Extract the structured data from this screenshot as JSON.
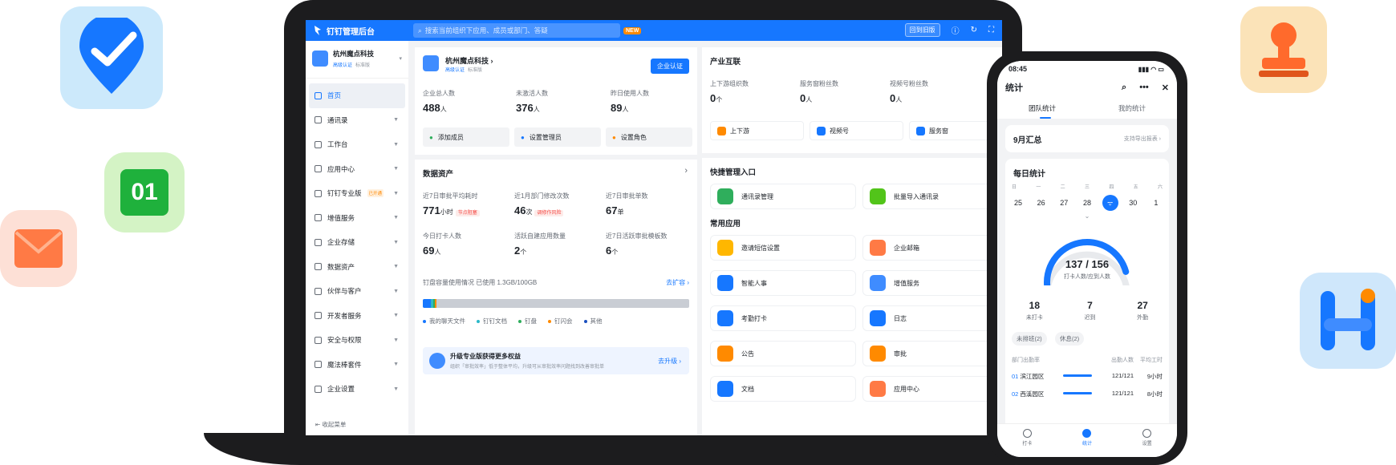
{
  "window": {
    "title": "钉钉管理后台"
  },
  "topbar": {
    "search_placeholder": "搜索当前组织下应用、成员或部门、答疑",
    "new_badge": "NEW",
    "back_old_label": "回到旧版"
  },
  "sidebar": {
    "org_name": "杭州魔点科技",
    "org_tag1": "高级认证",
    "org_tag2": "标准版",
    "items": [
      {
        "label": "首页"
      },
      {
        "label": "通讯录"
      },
      {
        "label": "工作台"
      },
      {
        "label": "应用中心"
      },
      {
        "label": "钉钉专业版",
        "badge": "已开通"
      },
      {
        "label": "增值服务"
      },
      {
        "label": "企业存储"
      },
      {
        "label": "数据资产"
      },
      {
        "label": "伙伴与客户"
      },
      {
        "label": "开发者服务"
      },
      {
        "label": "安全与权限"
      },
      {
        "label": "魔法棒套件"
      },
      {
        "label": "企业设置"
      }
    ],
    "collapse_label": "收起菜单"
  },
  "org_card": {
    "name": "杭州魔点科技",
    "tag1": "高级认证",
    "tag2": "标准版",
    "certify_button": "企业认证",
    "stats": [
      {
        "label": "企业总人数",
        "value": "488",
        "unit": "人"
      },
      {
        "label": "未激活人数",
        "value": "376",
        "unit": "人"
      },
      {
        "label": "昨日使用人数",
        "value": "89",
        "unit": "人"
      }
    ],
    "actions": [
      "添加成员",
      "设置管理员",
      "设置角色"
    ]
  },
  "data_assets": {
    "title": "数据资产",
    "stats": [
      {
        "label": "近7日审批平均耗时",
        "value": "771",
        "unit": "小时",
        "pill": "节点阻塞"
      },
      {
        "label": "近1月部门修改次数",
        "value": "46",
        "unit": "次",
        "pill": "调修作风险"
      },
      {
        "label": "近7日审批单数",
        "value": "67",
        "unit": "单"
      },
      {
        "label": "今日打卡人数",
        "value": "69",
        "unit": "人"
      },
      {
        "label": "活跃自建应用数量",
        "value": "2",
        "unit": "个"
      },
      {
        "label": "近7日活跃审批模板数",
        "value": "6",
        "unit": "个"
      }
    ],
    "storage_text": "钉盘容量使用情况 已使用 1.3GB/100GB",
    "expand_link": "去扩容",
    "legend": [
      {
        "label": "我的聊天文件",
        "color": "#1677ff"
      },
      {
        "label": "钉钉文档",
        "color": "#2bb8c9"
      },
      {
        "label": "钉盘",
        "color": "#2fae5c"
      },
      {
        "label": "钉闪会",
        "color": "#ff8a00"
      },
      {
        "label": "其他",
        "color": "#1a4fbf"
      }
    ],
    "upgrade_title": "升级专业版获得更多权益",
    "upgrade_desc": "组织「审批效率」低于整体平均，升级可从审批效率问题找到改善审批单",
    "upgrade_link": "去升级"
  },
  "industry": {
    "title": "产业互联",
    "stats": [
      {
        "label": "上下游组织数",
        "value": "0",
        "unit": "个"
      },
      {
        "label": "服务窗粉丝数",
        "value": "0",
        "unit": "人"
      },
      {
        "label": "视频号粉丝数",
        "value": "0",
        "unit": "人"
      }
    ],
    "chips": [
      {
        "label": "上下游",
        "color": "#ff8a00"
      },
      {
        "label": "视频号",
        "color": "#1677ff"
      },
      {
        "label": "服务窗",
        "color": "#1677ff"
      }
    ]
  },
  "quick": {
    "title": "快捷管理入口",
    "items": [
      {
        "label": "通讯录管理",
        "color": "#2fae5c"
      },
      {
        "label": "批量导入通讯录",
        "color": "#52c41a"
      }
    ]
  },
  "common_apps": {
    "title": "常用应用",
    "items": [
      {
        "label": "邀请短信设置",
        "color": "#ffb700"
      },
      {
        "label": "企业邮箱",
        "color": "#ff7a45"
      },
      {
        "label": "智能人事",
        "color": "#1677ff"
      },
      {
        "label": "增值服务",
        "color": "#3f8cff"
      },
      {
        "label": "考勤打卡",
        "color": "#1677ff"
      },
      {
        "label": "日志",
        "color": "#1677ff"
      },
      {
        "label": "公告",
        "color": "#ff8a00"
      },
      {
        "label": "审批",
        "color": "#ff8a00"
      },
      {
        "label": "文档",
        "color": "#1677ff"
      },
      {
        "label": "应用中心",
        "color": "#ff7a45"
      }
    ]
  },
  "phone": {
    "time": "08:45",
    "title": "统计",
    "tabs": [
      "团队统计",
      "我的统计"
    ],
    "month_title": "9月汇总",
    "export_link": "支持导出报表",
    "daily_title": "每日统计",
    "weekdays": [
      "日",
      "一",
      "二",
      "三",
      "四",
      "五",
      "六"
    ],
    "dates": [
      "25",
      "26",
      "27",
      "28",
      "29",
      "30",
      "1"
    ],
    "gauge_value": "137 / 156",
    "gauge_label": "打卡人数/应到人数",
    "gauge_fraction": 0.878,
    "summary": [
      {
        "value": "18",
        "label": "未打卡"
      },
      {
        "value": "7",
        "label": "迟到"
      },
      {
        "value": "27",
        "label": "外勤"
      }
    ],
    "tags": [
      "未排班(2)",
      "休息(2)"
    ],
    "dept_header": {
      "col1": "部门出勤率",
      "col2": "出勤人数",
      "col3": "平均工时"
    },
    "depts": [
      {
        "idx": "01",
        "name": "滨江园区",
        "count": "121/121",
        "hours": "9小时"
      },
      {
        "idx": "02",
        "name": "西溪园区",
        "count": "121/121",
        "hours": "8小时"
      }
    ],
    "nav": [
      "打卡",
      "统计",
      "设置"
    ]
  },
  "floating_icons": {
    "app_badge_number": "01"
  }
}
